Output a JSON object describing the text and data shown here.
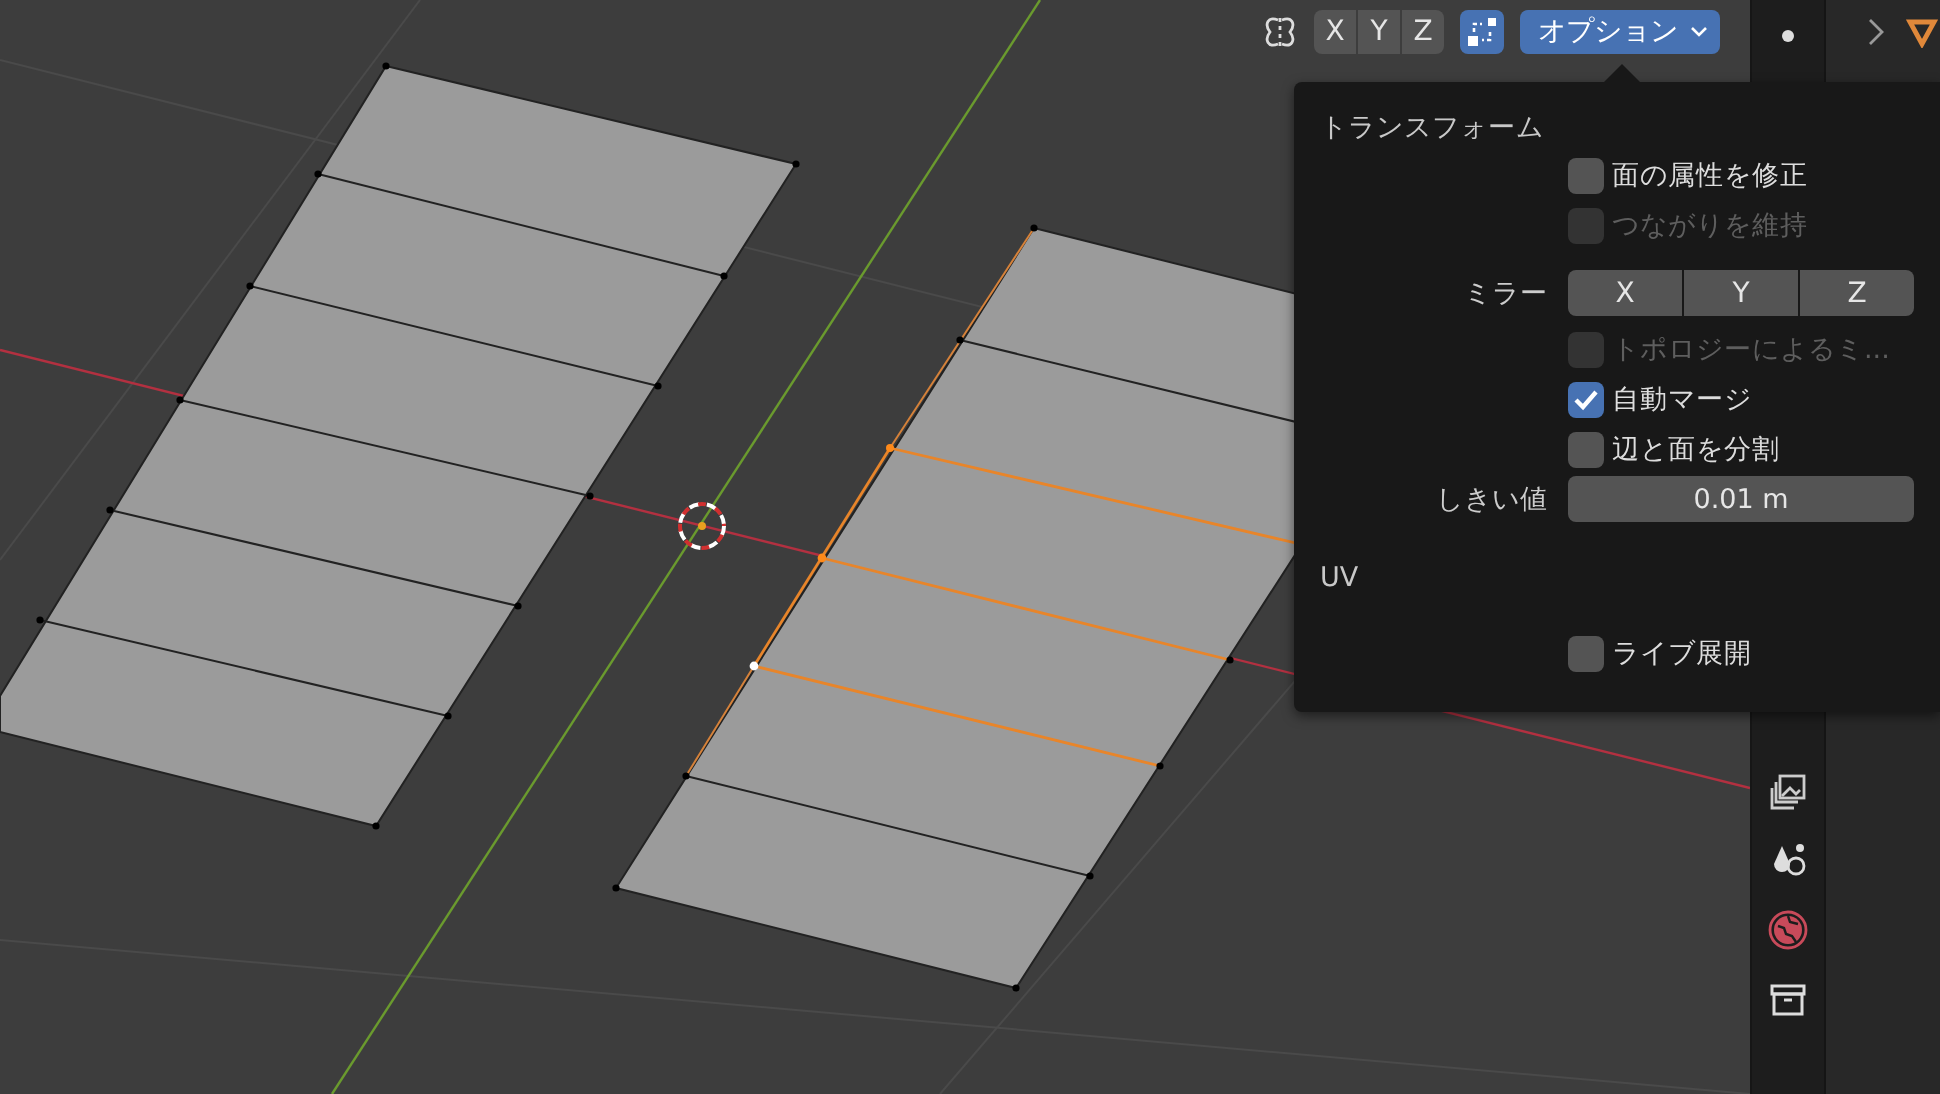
{
  "header": {
    "axes": [
      {
        "label": "X",
        "selected": false
      },
      {
        "label": "Y",
        "selected": false
      },
      {
        "label": "Z",
        "selected": false
      }
    ],
    "snap_toggle": {
      "on": true
    },
    "options_button": "オプション"
  },
  "popup": {
    "sections": [
      {
        "title": "トランスフォーム",
        "rows": [
          {
            "kind": "checkbox",
            "label": "面の属性を修正",
            "checked": false,
            "disabled": false
          },
          {
            "kind": "checkbox",
            "label": "つながりを維持",
            "checked": false,
            "disabled": true
          },
          {
            "kind": "toggles",
            "label": "ミラー",
            "buttons": [
              {
                "label": "X",
                "selected": false
              },
              {
                "label": "Y",
                "selected": false
              },
              {
                "label": "Z",
                "selected": false
              }
            ]
          },
          {
            "kind": "checkbox",
            "label": "トポロジーによるミ...",
            "checked": false,
            "disabled": true
          },
          {
            "kind": "checkbox",
            "label": "自動マージ",
            "checked": true,
            "disabled": false
          },
          {
            "kind": "checkbox",
            "label": "辺と面を分割",
            "checked": false,
            "disabled": false
          },
          {
            "kind": "number",
            "label": "しきい値",
            "value": "0.01 m"
          }
        ]
      },
      {
        "title": "UV",
        "rows": [
          {
            "kind": "checkbox",
            "label": "ライブ展開",
            "checked": false,
            "disabled": false
          }
        ]
      }
    ]
  }
}
